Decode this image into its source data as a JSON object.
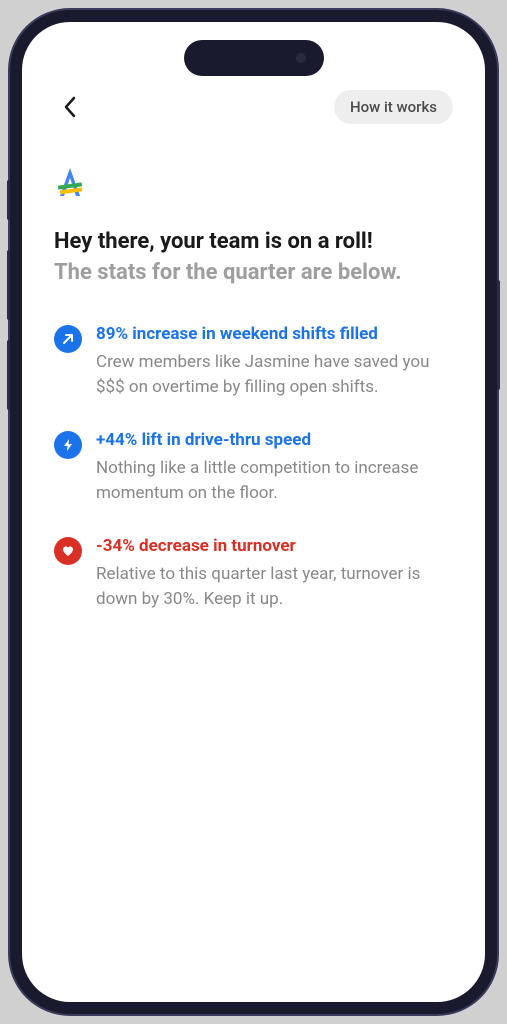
{
  "header": {
    "howItWorks": "How it works"
  },
  "title": "Hey there, your team is on a roll!",
  "subtitle": "The stats for the quarter are below.",
  "stats": [
    {
      "heading": "89% increase in weekend shifts filled",
      "description": "Crew members like Jasmine have saved you $$$ on overtime by filling open shifts."
    },
    {
      "heading": "+44% lift in drive-thru speed",
      "description": "Nothing like a little competition to increase momentum on the floor."
    },
    {
      "heading": "-34% decrease in turnover",
      "description": "Relative to this quarter last year, turnover is down by 30%. Keep it up."
    }
  ]
}
